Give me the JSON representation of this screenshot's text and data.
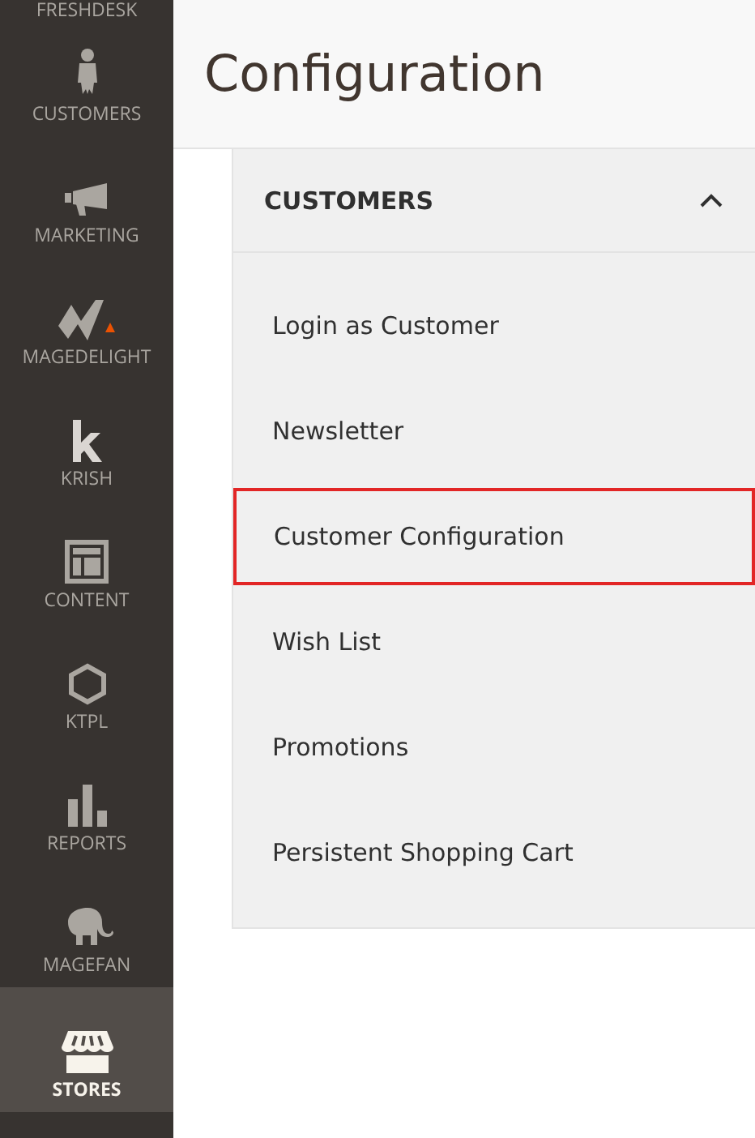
{
  "sidebar": {
    "items": [
      {
        "label": "FRESHDESK",
        "selected": false
      },
      {
        "label": "CUSTOMERS",
        "selected": false
      },
      {
        "label": "MARKETING",
        "selected": false
      },
      {
        "label": "MAGEDELIGHT",
        "selected": false
      },
      {
        "label": "KRISH",
        "selected": false
      },
      {
        "label": "CONTENT",
        "selected": false
      },
      {
        "label": "KTPL",
        "selected": false
      },
      {
        "label": "REPORTS",
        "selected": false
      },
      {
        "label": "MAGEFAN",
        "selected": false
      },
      {
        "label": "STORES",
        "selected": true
      }
    ]
  },
  "page_title": "Configuration",
  "section": {
    "title": "CUSTOMERS",
    "expanded": true,
    "items": [
      {
        "label": "Login as Customer",
        "selected": false
      },
      {
        "label": "Newsletter",
        "selected": false
      },
      {
        "label": "Customer Configuration",
        "selected": true
      },
      {
        "label": "Wish List",
        "selected": false
      },
      {
        "label": "Promotions",
        "selected": false
      },
      {
        "label": "Persistent Shopping Cart",
        "selected": false
      }
    ]
  }
}
